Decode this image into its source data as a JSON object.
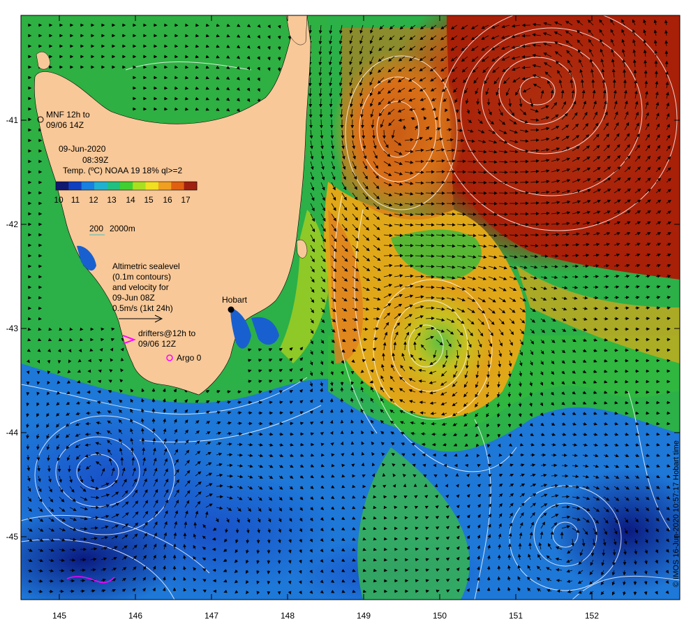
{
  "map": {
    "date_line": "09-Jun-2020",
    "time_line": "08:39Z",
    "sst_label": "Temp. (ºC) NOAA 19 18% ql>=2",
    "colorbar_ticks": [
      "10",
      "11",
      "12",
      "13",
      "14",
      "15",
      "16",
      "17"
    ],
    "colorbar_colors": [
      "#101870",
      "#1040c0",
      "#1880e0",
      "#20b0d0",
      "#20c080",
      "#40d030",
      "#a8e020",
      "#f0e020",
      "#f0a020",
      "#e06010",
      "#a02010"
    ],
    "mnf_line1": "MNF 12h to",
    "mnf_line2": "09/06 14Z",
    "depth_200": "200",
    "depth_2000": "2000m",
    "alt_lines": [
      "Altimetric sealevel",
      "(0.1m contours)",
      "and velocity for",
      "09-Jun 08Z",
      "0.5m/s (1kt 24h)"
    ],
    "hobart": "Hobart",
    "drifters_line1": "drifters@12h to",
    "drifters_line2": "09/06 12Z",
    "argo": "Argo 0",
    "credit": "© IMOS 16-Jun-2020 10:57:17 Hobart time",
    "lon_ticks": [
      "145",
      "146",
      "147",
      "148",
      "149",
      "150",
      "151",
      "152"
    ],
    "lat_ticks": [
      "-41",
      "-42",
      "-43",
      "-44",
      "-45"
    ],
    "colors": {
      "land": "#f8c898",
      "contour": "#ffffff",
      "drifter": "#ff00ff",
      "arrow": "#000000"
    }
  }
}
